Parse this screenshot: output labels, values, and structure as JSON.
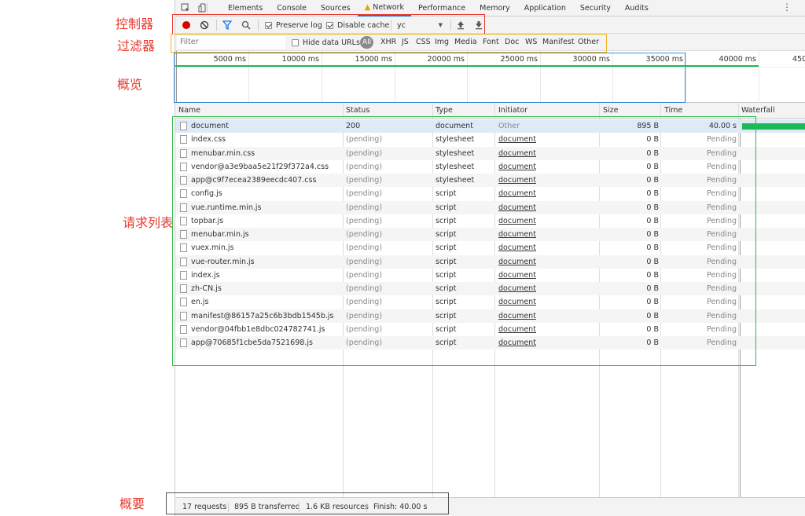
{
  "annotations": {
    "controller": "控制器",
    "filter": "过滤器",
    "overview": "概览",
    "request_list": "请求列表",
    "summary": "概要",
    "colors": {
      "controller": "#e8382e",
      "filter": "#f0b429",
      "overview": "#3b8de0",
      "request_list": "#2fb84a",
      "summary": "#555555"
    }
  },
  "tabs": {
    "items": [
      {
        "label": "Elements"
      },
      {
        "label": "Console"
      },
      {
        "label": "Sources"
      },
      {
        "label": "Network",
        "active": true,
        "icon": "warning-icon"
      },
      {
        "label": "Performance"
      },
      {
        "label": "Memory"
      },
      {
        "label": "Application"
      },
      {
        "label": "Security"
      },
      {
        "label": "Audits"
      }
    ],
    "icons": [
      "inspect-icon",
      "device-toggle-icon",
      "more-menu-icon"
    ]
  },
  "toolbar": {
    "icons": [
      "record-icon",
      "clear-icon",
      "filter-icon",
      "search-icon",
      "import-icon",
      "export-icon"
    ],
    "preserve_log": "Preserve log",
    "disable_cache": "Disable cache",
    "throttle_value": "yc"
  },
  "filterbar": {
    "placeholder": "Filter",
    "hide_data_urls": "Hide data URLs",
    "types": [
      "All",
      "XHR",
      "JS",
      "CSS",
      "Img",
      "Media",
      "Font",
      "Doc",
      "WS",
      "Manifest",
      "Other"
    ]
  },
  "overview": {
    "ticks": [
      "5000 ms",
      "10000 ms",
      "15000 ms",
      "20000 ms",
      "25000 ms",
      "30000 ms",
      "35000 ms",
      "40000 ms",
      "450"
    ]
  },
  "table": {
    "headers": {
      "name": "Name",
      "status": "Status",
      "type": "Type",
      "initiator": "Initiator",
      "size": "Size",
      "time": "Time",
      "waterfall": "Waterfall"
    },
    "rows": [
      {
        "name": "document",
        "status": "200",
        "type": "document",
        "initiator": "Other",
        "size": "895 B",
        "time": "40.00 s"
      },
      {
        "name": "index.css",
        "status": "(pending)",
        "type": "stylesheet",
        "initiator": "document",
        "size": "0 B",
        "time": "Pending"
      },
      {
        "name": "menubar.min.css",
        "status": "(pending)",
        "type": "stylesheet",
        "initiator": "document",
        "size": "0 B",
        "time": "Pending"
      },
      {
        "name": "vendor@a3e9baa5e21f29f372a4.css",
        "status": "(pending)",
        "type": "stylesheet",
        "initiator": "document",
        "size": "0 B",
        "time": "Pending"
      },
      {
        "name": "app@c9f7ecea2389eecdc407.css",
        "status": "(pending)",
        "type": "stylesheet",
        "initiator": "document",
        "size": "0 B",
        "time": "Pending"
      },
      {
        "name": "config.js",
        "status": "(pending)",
        "type": "script",
        "initiator": "document",
        "size": "0 B",
        "time": "Pending"
      },
      {
        "name": "vue.runtime.min.js",
        "status": "(pending)",
        "type": "script",
        "initiator": "document",
        "size": "0 B",
        "time": "Pending"
      },
      {
        "name": "topbar.js",
        "status": "(pending)",
        "type": "script",
        "initiator": "document",
        "size": "0 B",
        "time": "Pending"
      },
      {
        "name": "menubar.min.js",
        "status": "(pending)",
        "type": "script",
        "initiator": "document",
        "size": "0 B",
        "time": "Pending"
      },
      {
        "name": "vuex.min.js",
        "status": "(pending)",
        "type": "script",
        "initiator": "document",
        "size": "0 B",
        "time": "Pending"
      },
      {
        "name": "vue-router.min.js",
        "status": "(pending)",
        "type": "script",
        "initiator": "document",
        "size": "0 B",
        "time": "Pending"
      },
      {
        "name": "index.js",
        "status": "(pending)",
        "type": "script",
        "initiator": "document",
        "size": "0 B",
        "time": "Pending"
      },
      {
        "name": "zh-CN.js",
        "status": "(pending)",
        "type": "script",
        "initiator": "document",
        "size": "0 B",
        "time": "Pending"
      },
      {
        "name": "en.js",
        "status": "(pending)",
        "type": "script",
        "initiator": "document",
        "size": "0 B",
        "time": "Pending"
      },
      {
        "name": "manifest@86157a25c6b3bdb1545b.js",
        "status": "(pending)",
        "type": "script",
        "initiator": "document",
        "size": "0 B",
        "time": "Pending"
      },
      {
        "name": "vendor@04fbb1e8dbc024782741.js",
        "status": "(pending)",
        "type": "script",
        "initiator": "document",
        "size": "0 B",
        "time": "Pending"
      },
      {
        "name": "app@70685f1cbe5da7521698.js",
        "status": "(pending)",
        "type": "script",
        "initiator": "document",
        "size": "0 B",
        "time": "Pending"
      }
    ]
  },
  "summary": {
    "requests": "17 requests",
    "transferred": "895 B transferred",
    "resources": "1.6 KB resources",
    "finish": "Finish: 40.00 s"
  }
}
